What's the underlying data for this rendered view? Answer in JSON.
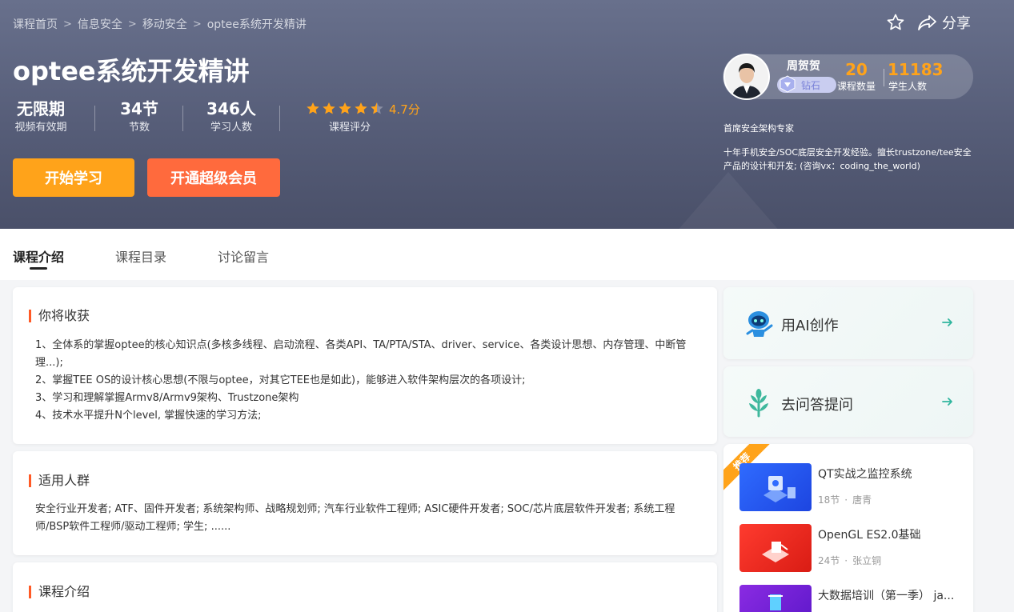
{
  "breadcrumb": {
    "items": [
      "课程首页",
      "信息安全",
      "移动安全",
      "optee系统开发精讲"
    ],
    "separator": ">"
  },
  "actions": {
    "share_label": "分享",
    "star_icon": "star-icon",
    "share_icon": "share-icon"
  },
  "course": {
    "title": "optee系统开发精讲",
    "stats": [
      {
        "value": "无限期",
        "label": "视频有效期"
      },
      {
        "value": "34节",
        "label": "节数"
      },
      {
        "value": "346人",
        "label": "学习人数"
      }
    ],
    "rating": {
      "stars": 4.5,
      "score": "4.7分",
      "label": "课程评分"
    }
  },
  "buttons": {
    "start": "开始学习",
    "vip": "开通超级会员"
  },
  "teacher": {
    "name": "周贺贺",
    "badge": "钻石",
    "course_count": "20",
    "course_count_label": "课程数量",
    "student_count": "11183",
    "student_count_label": "学生人数",
    "title": "首席安全架构专家",
    "desc": "十年手机安全/SOC底层安全开发经验。擅长trustzone/tee安全产品的设计和开发; (咨询vx：coding_the_world)"
  },
  "tabs": [
    "课程介绍",
    "课程目录",
    "讨论留言"
  ],
  "sections": {
    "gain": {
      "title": "你将收获",
      "lines": [
        "1、全体系的掌握optee的核心知识点(多核多线程、启动流程、各类API、TA/PTA/STA、driver、service、各类设计思想、内存管理、中断管理...);",
        "2、掌握TEE OS的设计核心思想(不限与optee，对其它TEE也是如此)，能够进入软件架构层次的各项设计;",
        "3、学习和理解掌握Armv8/Armv9架构、Trustzone架构",
        "4、技术水平提升N个level, 掌握快速的学习方法;"
      ]
    },
    "audience": {
      "title": "适用人群",
      "text": "安全行业开发者; ATF、固件开发者; 系统架构师、战略规划师; 汽车行业软件工程师; ASIC硬件开发者; SOC/芯片底层软件开发者; 系统工程师/BSP软件工程师/驱动工程师; 学生; ......"
    },
    "intro": {
      "title": "课程介绍"
    }
  },
  "sidebar": {
    "ai": {
      "label": "用AI创作",
      "icon": "robot-icon"
    },
    "qa": {
      "label": "去问答提问",
      "icon": "wheat-icon"
    },
    "recommend": {
      "ribbon": "推荐",
      "items": [
        {
          "title": "QT实战之监控系统",
          "lessons": "18节",
          "author": "唐青"
        },
        {
          "title": "OpenGL ES2.0基础",
          "lessons": "24节",
          "author": "张立铜"
        },
        {
          "title": "大数据培训（第一季） ja...",
          "lessons": "",
          "author": ""
        }
      ]
    }
  },
  "colors": {
    "accent": "#ffa31a",
    "vip": "#ff6a3d",
    "section_bar": "#ff5a26",
    "hero_bg": "#5a617b"
  }
}
